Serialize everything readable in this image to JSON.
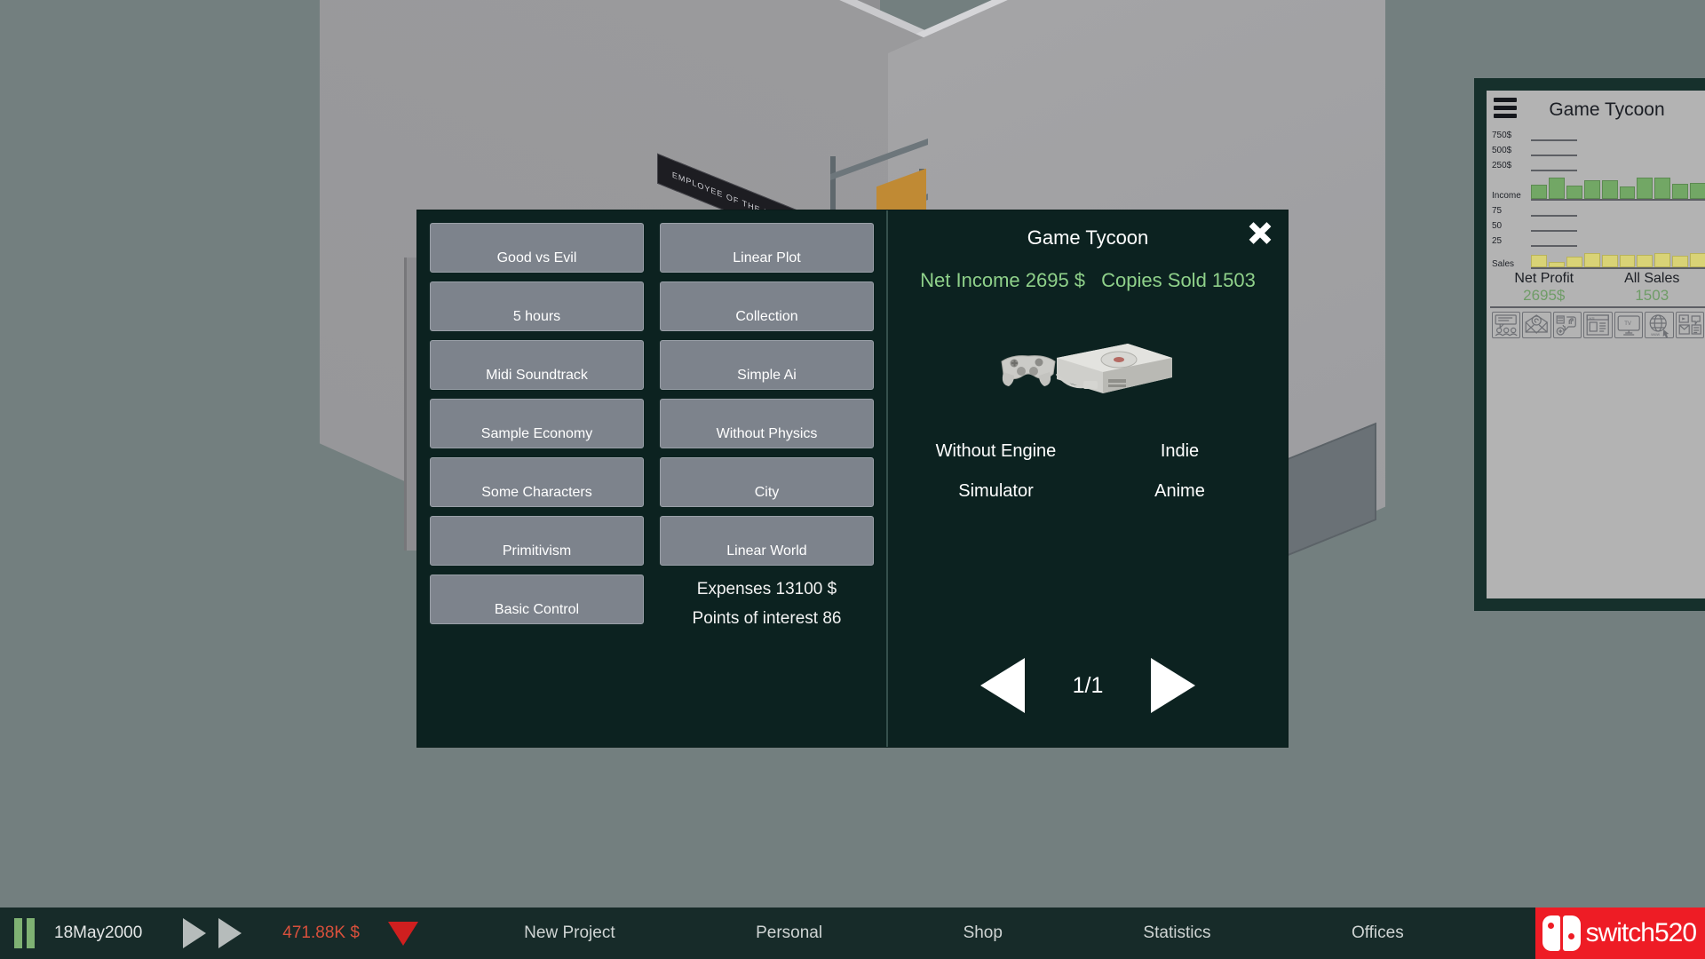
{
  "scene": {
    "wall_banner": "EMPLOYEE OF THE MONTH"
  },
  "modal": {
    "title": "Game Tycoon",
    "close_icon": "close-icon",
    "features_left": [
      "Good vs Evil",
      "5 hours",
      "Midi Soundtrack",
      "Sample Economy",
      "Some Characters",
      "Primitivism",
      "Basic Control"
    ],
    "features_right": [
      "Linear Plot",
      "Collection",
      "Simple Ai",
      "Without Physics",
      "City",
      "Linear World"
    ],
    "summary": {
      "expenses": "Expenses 13100 $",
      "points_of_interest": "Points of interest 86"
    },
    "earnings": {
      "net_income": "Net Income 2695 $",
      "copies_sold": "Copies Sold 1503",
      "color": "#8fd18a"
    },
    "console_art": "playstation-console-icon",
    "genres": [
      "Without Engine",
      "Indie",
      "Simulator",
      "Anime"
    ],
    "pager": {
      "prev_icon": "arrow-left-icon",
      "next_icon": "arrow-right-icon",
      "label": "1/1"
    }
  },
  "sidebar": {
    "menu_icon": "hamburger-icon",
    "title": "Game Tycoon",
    "axis_labels": [
      "750$",
      "500$",
      "250$",
      "Income",
      "75",
      "50",
      "25",
      "Sales"
    ],
    "totals": [
      {
        "label": "Net Profit",
        "value": "2695$"
      },
      {
        "label": "All Sales",
        "value": "1503"
      }
    ],
    "marketing_icons": [
      "forum-icon",
      "email-icon",
      "social-media-icon",
      "newspaper-ad-icon",
      "tv-icon",
      "web-www-icon",
      "media-campaign-icon"
    ],
    "colors": {
      "income_bar": "#72a765",
      "sales_bar": "#d9d376",
      "value_text": "#6f9c67"
    }
  },
  "chart_data": {
    "type": "bar",
    "title": "Game Tycoon",
    "xlabel": "",
    "ylabel": "",
    "grid": true,
    "legend_position": "none",
    "panels": [
      {
        "name": "Income",
        "ylabel": "Income",
        "tick_labels": [
          "250$",
          "500$",
          "750$"
        ],
        "ylim": [
          0,
          1000
        ],
        "color": "#72a765",
        "values": [
          135,
          205,
          130,
          180,
          180,
          120,
          200,
          205,
          145,
          150
        ]
      },
      {
        "name": "Sales",
        "ylabel": "Sales",
        "tick_labels": [
          "25",
          "50",
          "75"
        ],
        "ylim": [
          0,
          100
        ],
        "color": "#d9d376",
        "values": [
          17,
          7,
          14,
          19,
          17,
          17,
          17,
          19,
          16,
          19
        ]
      }
    ]
  },
  "taskbar": {
    "pause_icon": "pause-icon",
    "date": "18May2000",
    "speed_icons": [
      "play-icon",
      "fast-forward-icon"
    ],
    "money": "471.88K $",
    "money_color": "#d8503c",
    "trend_icon": "triangle-down-icon",
    "menu": [
      "New Project",
      "Personal",
      "Shop",
      "Statistics",
      "Offices"
    ],
    "watermark": {
      "text": "switch520",
      "icon": "nintendo-switch-icon",
      "color": "#ee1c25"
    }
  }
}
